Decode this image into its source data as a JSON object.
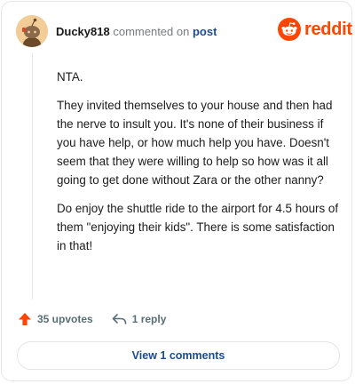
{
  "header": {
    "username": "Ducky818",
    "action_text": "commented on",
    "post_link": "post"
  },
  "logo": {
    "text": "reddit",
    "icon": "reddit-snoo-icon",
    "color": "#ff4500"
  },
  "comment": {
    "paragraphs": [
      "NTA.",
      "They invited themselves to your house and then had the nerve to insult you. It's none of their business if you have help, or how much help you have. Doesn't seem that they were willing to help so how was it all going to get done without Zara or the other nanny?",
      "Do enjoy the shuttle ride to the airport for 4.5 hours of them \"enjoying their kids\". There is some satisfaction in that!"
    ]
  },
  "actions": {
    "upvotes_label": "35 upvotes",
    "upvote_icon": "upvote-arrow-icon",
    "reply_label": "1 reply",
    "reply_icon": "reply-arrow-icon"
  },
  "view_comments_label": "View 1 comments",
  "colors": {
    "accent": "#ff4500",
    "link": "#1a4c8e",
    "meta": "#787c7e"
  }
}
